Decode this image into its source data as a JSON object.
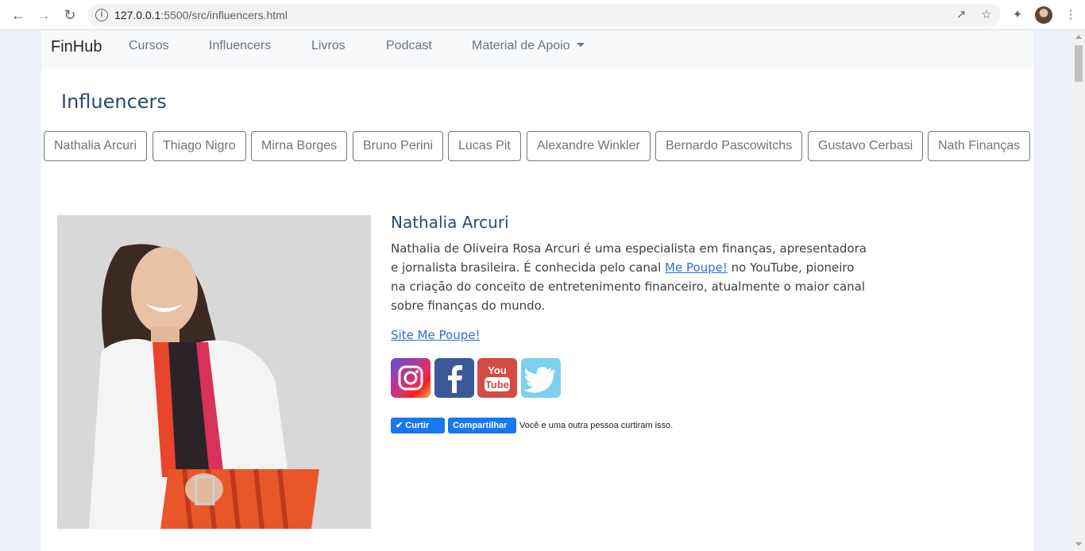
{
  "browser": {
    "url_host": "127.0.0.1",
    "url_rest": ":5500/src/influencers.html"
  },
  "navbar": {
    "brand": "FinHub",
    "links": [
      "Cursos",
      "Influencers",
      "Livros",
      "Podcast",
      "Material de Apoio"
    ]
  },
  "page": {
    "title": "Influencers"
  },
  "filters": [
    "Nathalia Arcuri",
    "Thiago Nigro",
    "Mirna Borges",
    "Bruno Perini",
    "Lucas Pit",
    "Alexandre Winkler",
    "Bernardo Pascowitchs",
    "Gustavo Cerbasi",
    "Nath Finanças"
  ],
  "profile": {
    "name": "Nathalia Arcuri",
    "bio_part1": "Nathalia de Oliveira Rosa Arcuri é uma especialista em finanças, apresentadora e jornalista brasileira. É conhecida pelo canal ",
    "bio_link": "Me Poupe!",
    "bio_part2": " no YouTube, pioneiro na criação do conceito de entretenimento financeiro, atualmente o maior canal sobre finanças do mundo.",
    "site_link": "Site Me Poupe!"
  },
  "social": {
    "like_label": "Curtir",
    "share_label": "Compartilhar",
    "like_text": "Você e uma outra pessoa curtiram isso."
  }
}
